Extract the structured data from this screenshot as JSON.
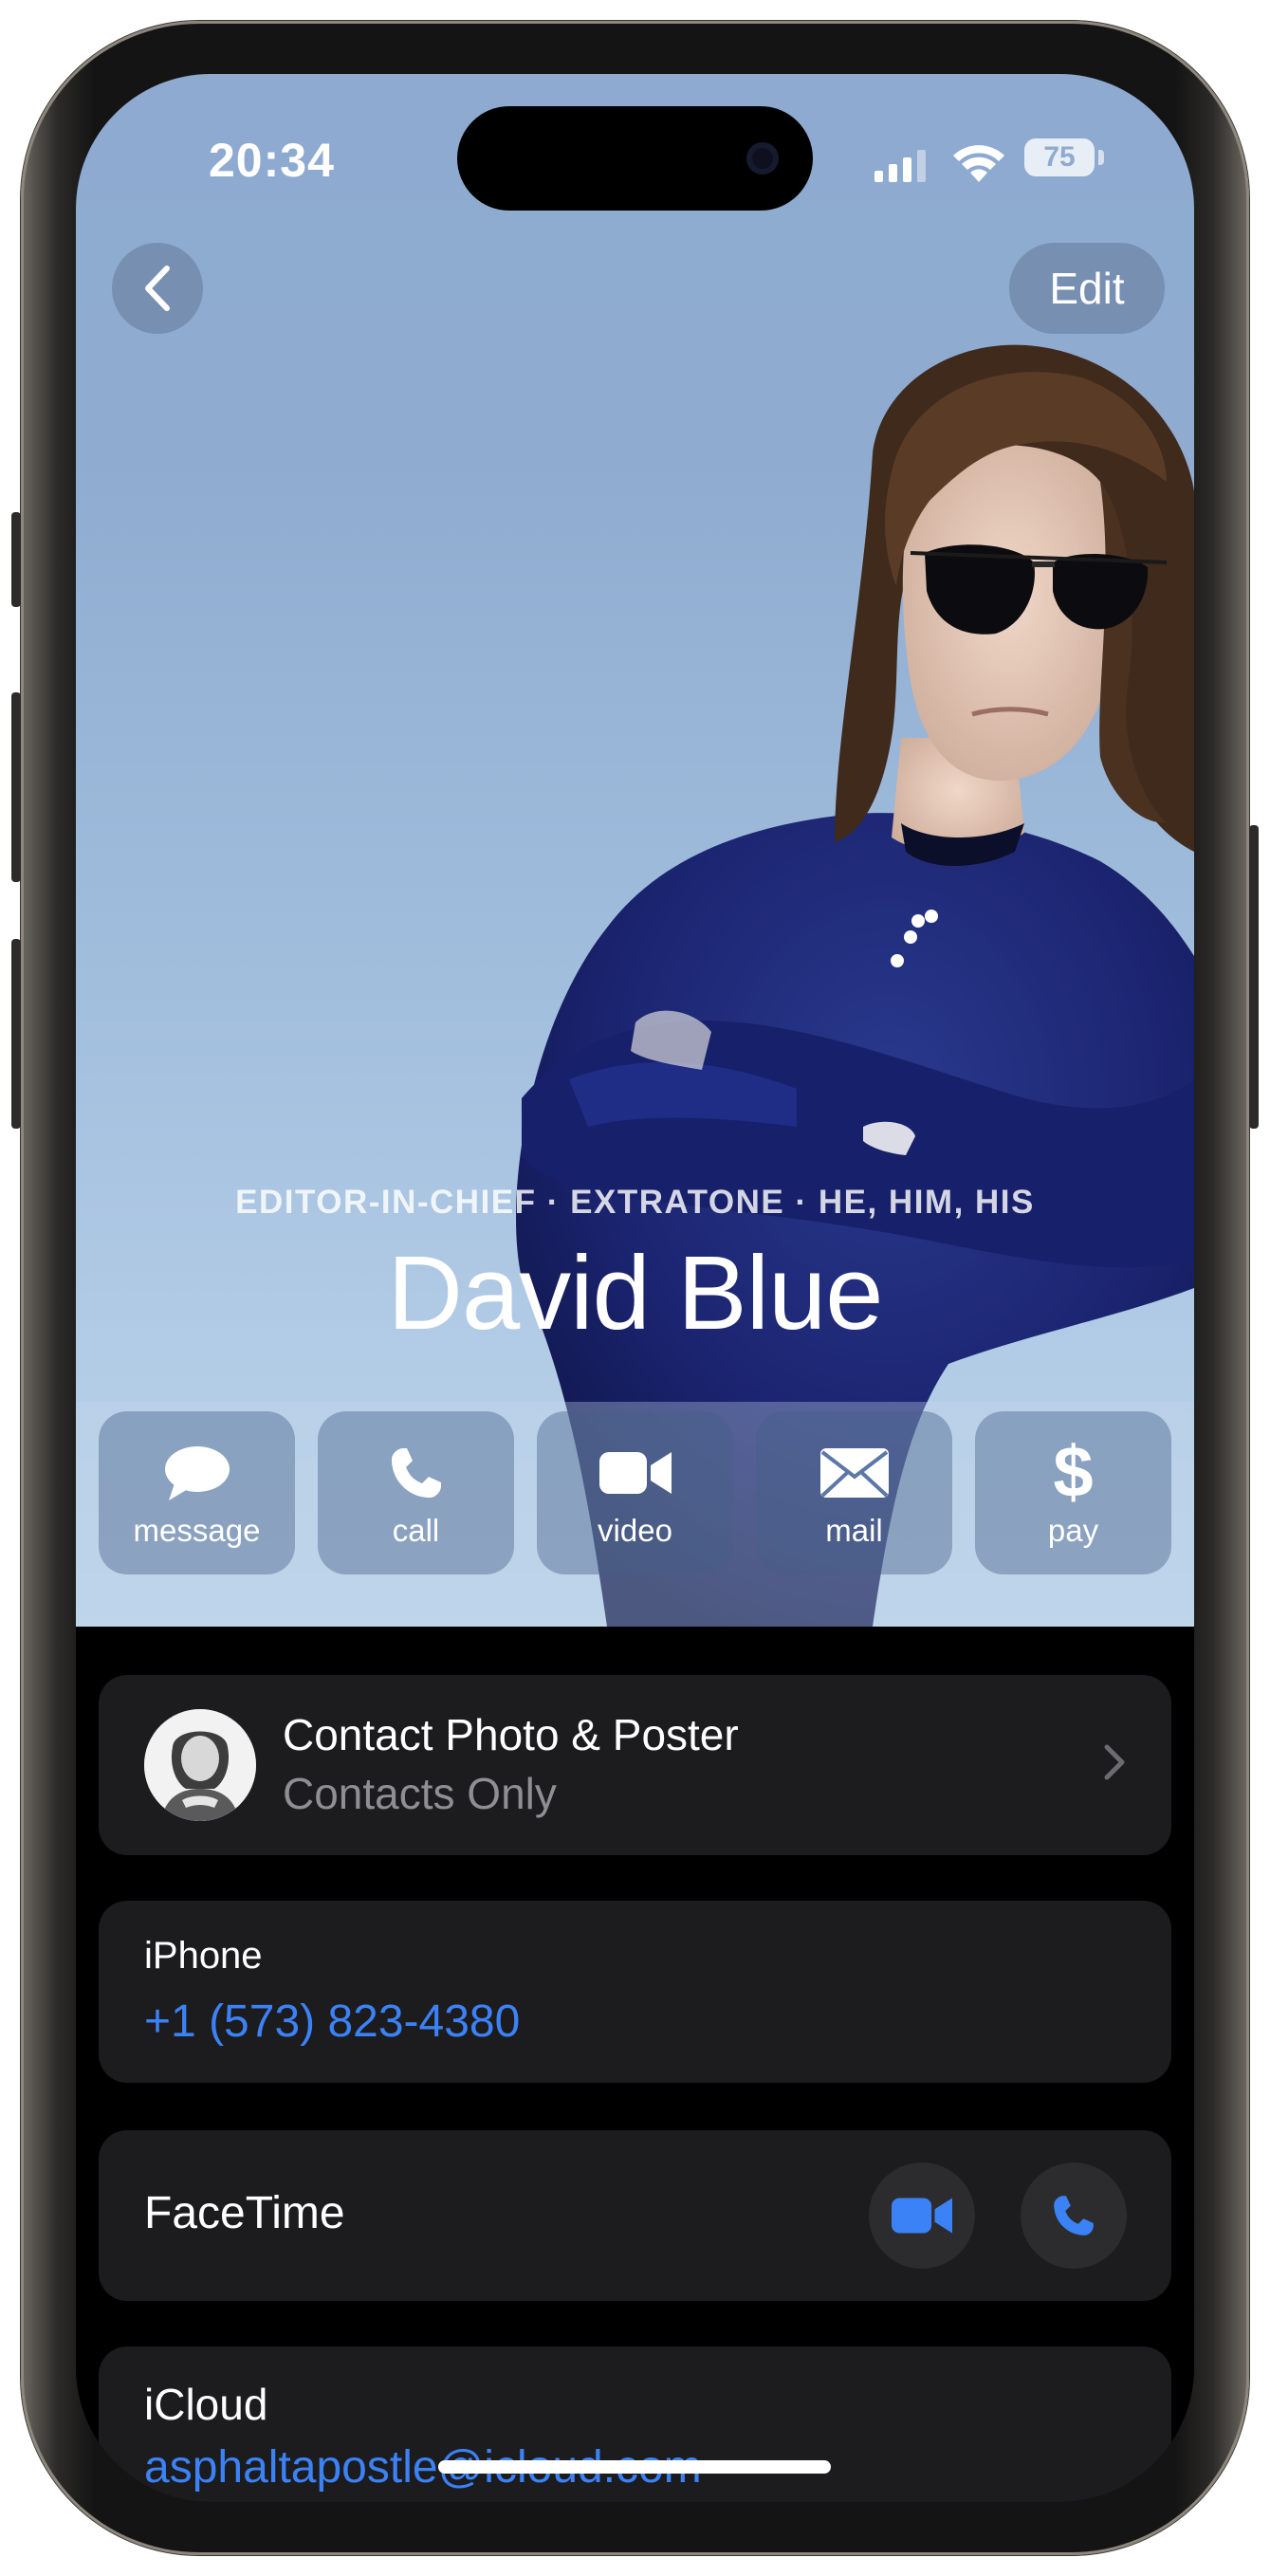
{
  "status_bar": {
    "time": "20:34",
    "battery_level": "75",
    "signal_icon": "cellular-signal-icon",
    "wifi_icon": "wifi-icon"
  },
  "header": {
    "back_icon": "chevron-left-icon",
    "edit_label": "Edit"
  },
  "poster": {
    "subtitle": "EDITOR-IN-CHIEF · EXTRATONE · HE, HIM, HIS",
    "name": "David Blue"
  },
  "actions": [
    {
      "label": "message",
      "icon": "message-bubble-icon"
    },
    {
      "label": "call",
      "icon": "phone-icon"
    },
    {
      "label": "video",
      "icon": "video-camera-icon"
    },
    {
      "label": "mail",
      "icon": "envelope-icon"
    },
    {
      "label": "pay",
      "icon": "dollar-icon"
    }
  ],
  "contact_poster_row": {
    "title": "Contact Photo & Poster",
    "subtitle": "Contacts Only"
  },
  "phone": {
    "label": "iPhone",
    "value": "+1 (573) 823-4380"
  },
  "facetime": {
    "label": "FaceTime"
  },
  "icloud": {
    "label": "iCloud",
    "value": "asphaltapostle@icloud.com"
  },
  "colors": {
    "accent_blue": "#3b82f6",
    "card_background": "#1c1c1e",
    "screen_background": "#000000",
    "poster_sky": "#9fbcdc"
  }
}
